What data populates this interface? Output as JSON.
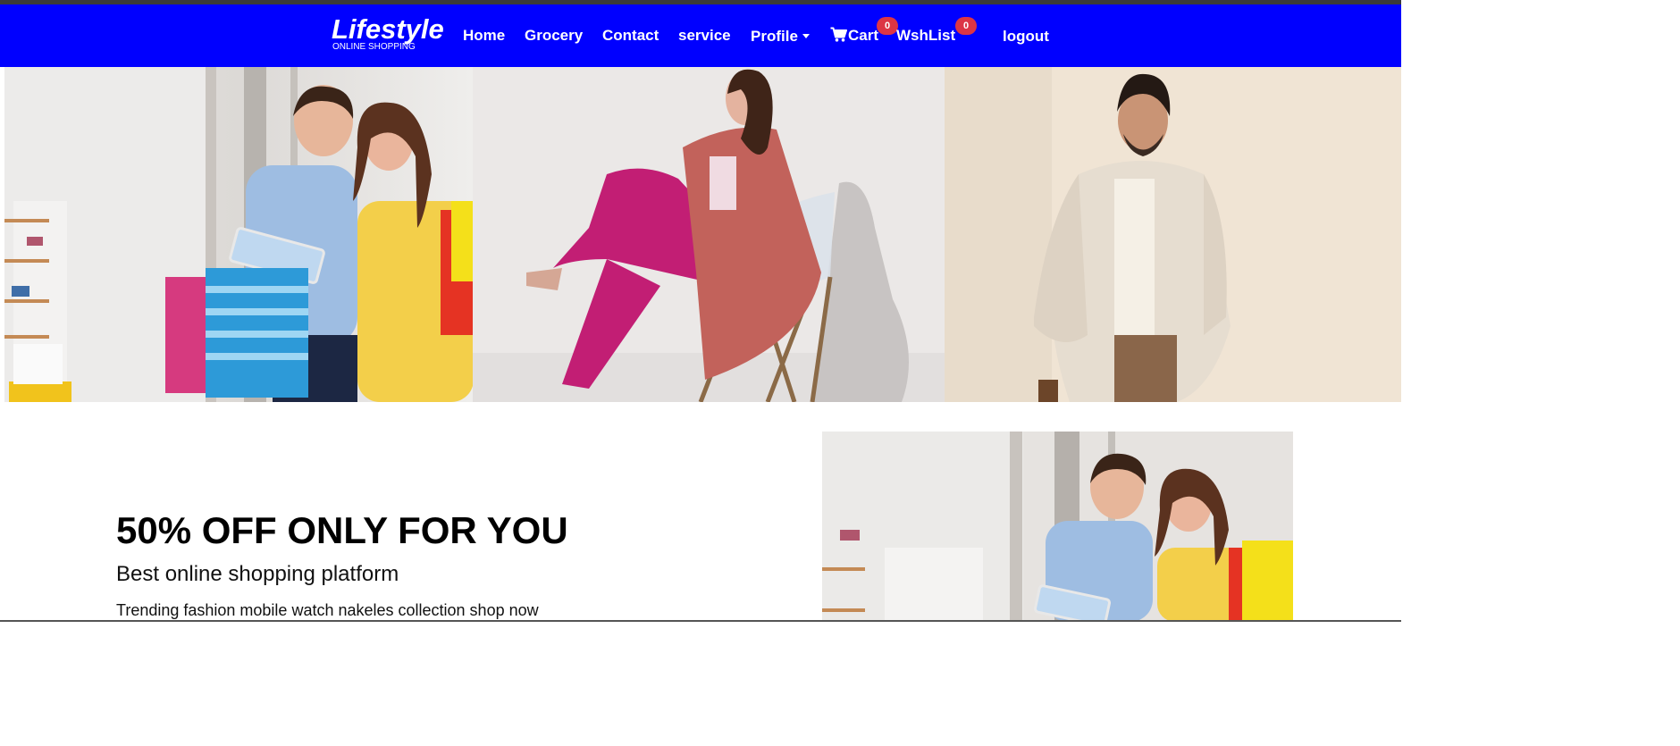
{
  "brand": {
    "title": "Lifestyle",
    "subtitle": "ONLINE SHOPPING"
  },
  "nav": {
    "home": "Home",
    "grocery": "Grocery",
    "contact": "Contact",
    "service": "service",
    "profile": "Profile",
    "cart": "Cart",
    "cart_count": "0",
    "wishlist": "WshList",
    "wishlist_count": "0",
    "logout": "logout"
  },
  "promo": {
    "headline": "50% OFF ONLY FOR YOU",
    "subhead": "Best online shopping platform",
    "tagline": "Trending fashion mobile watch nakeles collection shop now"
  },
  "colors": {
    "navbar": "#0000ff",
    "badge": "#dc3545",
    "text_on_nav": "#ffffff"
  },
  "icons": {
    "cart": "cart-icon",
    "profile_dropdown": "chevron-down-icon"
  }
}
